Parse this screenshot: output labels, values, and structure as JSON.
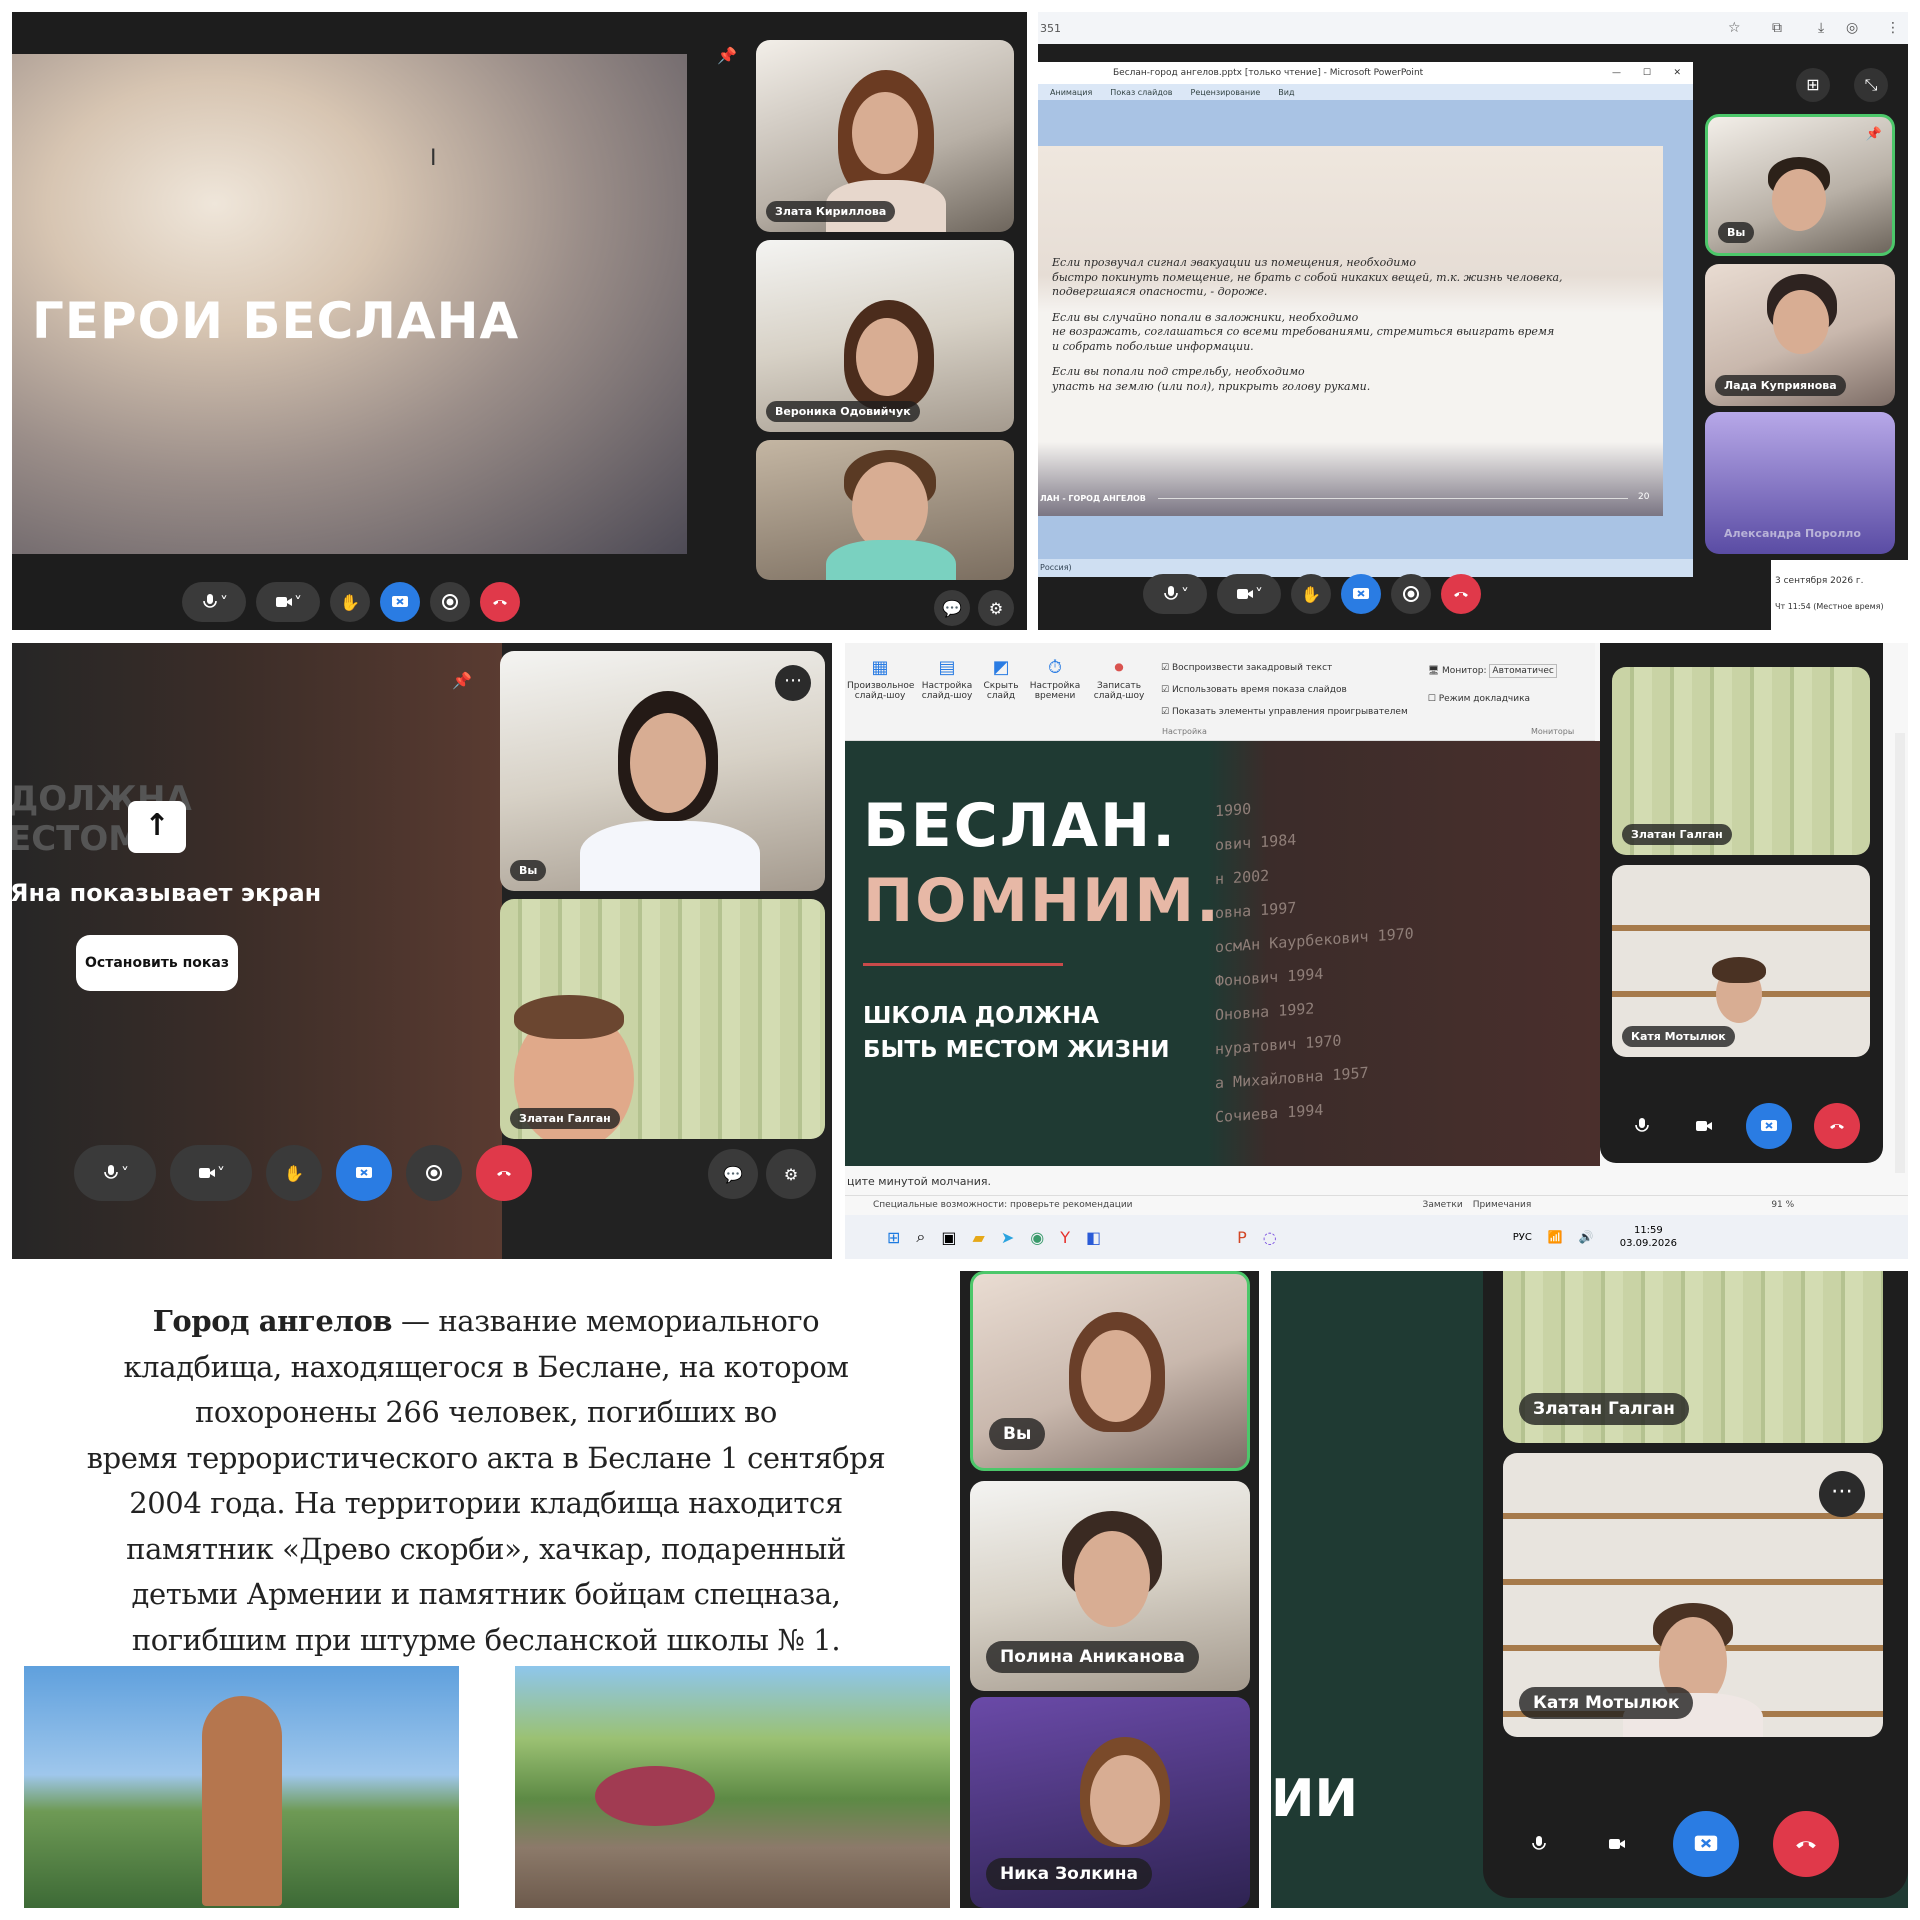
{
  "panel1": {
    "slide_title": "ГЕРОИ БЕСЛАНА",
    "participants": [
      "Злата Кириллова",
      "Вероника Одовийчук"
    ]
  },
  "panel2": {
    "address_fragment": "351",
    "window_title": "Беслан-город ангелов.pptx [только чтение] - Microsoft PowerPoint",
    "ribbon_tabs": [
      "Анимация",
      "Показ слайдов",
      "Рецензирование",
      "Вид"
    ],
    "slide_text": [
      "Если прозвучал сигнал эвакуации из помещения, необходимо",
      "быстро покинуть помещение, не брать с собой никаких вещей, т.к. жизнь человека,",
      "подвергшаяся опасности, - дороже.",
      "",
      "Если вы случайно попали в заложники, необходимо",
      "не возражать, соглашаться со всеми требованиями, стремиться выиграть время",
      "и собрать побольше информации.",
      "",
      "Если вы попали под стрельбу, необходимо",
      "упасть на землю (или пол), прикрыть голову руками."
    ],
    "slide_footer": "ЛАН - ГОРОД АНГЕЛОВ",
    "slide_number": "20",
    "status_left": "Россия)",
    "participants": [
      "Вы",
      "Лада Куприянова",
      "Александра Поролло"
    ],
    "date": "3 сентября 2026 г.",
    "time_label": "Чт 11:54 (Местное время)"
  },
  "panel3": {
    "bg_text_1": "ДОЛЖНА",
    "bg_text_2": "ЕСТОМ",
    "sharing_label": "Яна показывает экран",
    "stop_button": "Остановить показ",
    "participants": [
      "Вы",
      "Златан Галган"
    ]
  },
  "panel4": {
    "ribbon_items": [
      "Произвольное слайд-шоу",
      "Настройка слайд-шоу",
      "Скрыть слайд",
      "Настройка времени",
      "Записать слайд-шоу"
    ],
    "checks": [
      "Воспроизвести закадровый текст",
      "Использовать время показа слайдов",
      "Показать элементы управления проигрывателем"
    ],
    "group_label": "Настройка",
    "monitor_label": "Монитор:",
    "monitor_value": "Автоматичес",
    "presenter_mode": "Режим докладчика",
    "monitors_group": "Мониторы",
    "slide_title_1": "БЕСЛАН.",
    "slide_title_2": "ПОМНИМ.",
    "slide_subtitle_1": "ШКОЛА ДОЛЖНА",
    "slide_subtitle_2": "БЫТЬ МЕСТОМ ЖИЗНИ",
    "wall_names": [
      "1990",
      "ович 1984",
      "н 2002",
      "овна 1997",
      "осмАн Каурбекович 1970",
      "Фонович 1994",
      "Оновна 1992",
      "нуратович 1970",
      "а Михайловна 1957",
      "Сочиева 1994"
    ],
    "notes_text": "ците минутой молчания.",
    "status_accessibility": "Специальные возможности: проверьте рекомендации",
    "notes_btn": "Заметки",
    "comments_btn": "Примечания",
    "zoom": "91 %",
    "lang": "РУС",
    "clock_time": "11:59",
    "clock_date": "03.09.2026",
    "participants": [
      "Златан Галган",
      "Катя Мотылюк"
    ]
  },
  "panel5": {
    "lines": [
      [
        "Город ангелов",
        " — название мемориального"
      ],
      [
        "кладбища, находящегося в Беслане, на котором"
      ],
      [
        "похоронены 266 человек, погибших во"
      ],
      [
        "время террористического акта в Беслане 1 сентября"
      ],
      [
        "2004 года. На территории кладбища находится"
      ],
      [
        "памятник «Древо скорби», хачкар, подаренный"
      ],
      [
        "детьми Армении и памятник бойцам спецназа,"
      ],
      [
        "погибшим при штурме бесланской школы № 1."
      ]
    ],
    "participants": [
      "Вы",
      "Полина Аниканова",
      "Ника Золкина"
    ]
  },
  "panel6": {
    "bg_text": "ИИ",
    "participants": [
      "Златан Галган",
      "Катя Мотылюк"
    ]
  },
  "colors": {
    "accent_blue": "#2a7ce3",
    "end_red": "#e0394a",
    "slide_green": "#1f3a33",
    "memorial_pink": "#e7b8a6"
  }
}
